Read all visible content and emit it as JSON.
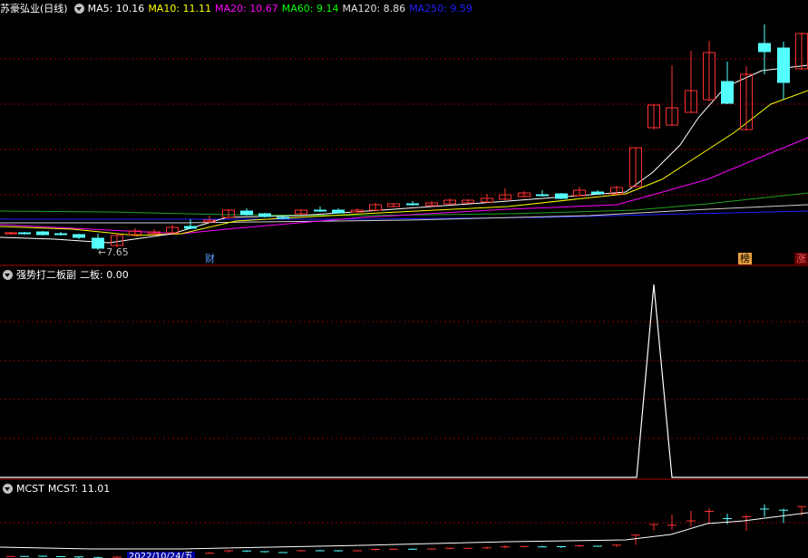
{
  "header": {
    "stock_name": "苏豪弘业(日线)",
    "ma": [
      {
        "label": "MA5: 10.16",
        "color": "#ffffff"
      },
      {
        "label": "MA10: 11.11",
        "color": "#ffff00"
      },
      {
        "label": "MA20: 10.67",
        "color": "#ff00ff"
      },
      {
        "label": "MA60: 9.14",
        "color": "#00ff00"
      },
      {
        "label": "MA120: 8.86",
        "color": "#e0e0e0"
      },
      {
        "label": "MA250: 9.59",
        "color": "#2020ff"
      }
    ]
  },
  "main": {
    "low_label": "←7.65",
    "badge_cai": "财",
    "badge_bang": "榜",
    "badge_zhang": "涨"
  },
  "indicator1": {
    "name": "强势打二板副",
    "value_label": "二板: 0.00",
    "name_color": "#ffffff",
    "value_color": "#ffffff"
  },
  "indicator2": {
    "name": "MCST",
    "value_label": "MCST: 11.01",
    "date_partial": "2022/10/24/五"
  },
  "colors": {
    "up": "#ff3232",
    "down": "#54ffff",
    "grid": "#8b0000",
    "border": "#b00000"
  }
}
